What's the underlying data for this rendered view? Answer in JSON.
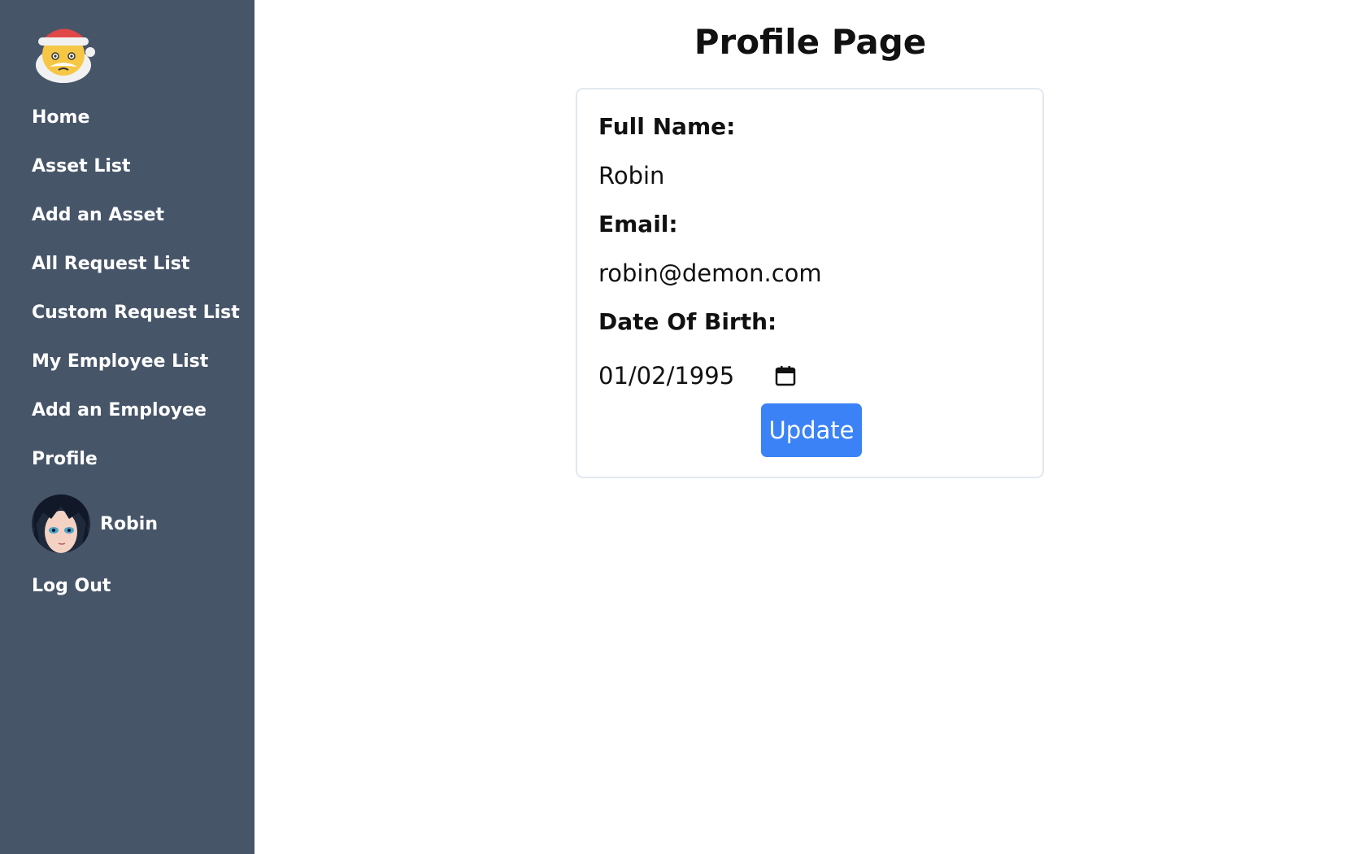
{
  "sidebar": {
    "logo_icon": "santa-emoji-icon",
    "items": [
      {
        "label": "Home"
      },
      {
        "label": "Asset List"
      },
      {
        "label": "Add an Asset"
      },
      {
        "label": "All Request List"
      },
      {
        "label": "Custom Request List"
      },
      {
        "label": "My Employee List"
      },
      {
        "label": "Add an Employee"
      },
      {
        "label": "Profile"
      }
    ],
    "user": {
      "name": "Robin",
      "avatar_icon": "user-avatar"
    },
    "logout_label": "Log Out",
    "background": "#475569"
  },
  "main": {
    "title": "Profile Page",
    "form": {
      "full_name_label": "Full Name:",
      "full_name_value": "Robin",
      "email_label": "Email:",
      "email_value": "robin@demon.com",
      "dob_label": "Date Of Birth:",
      "dob_value": "01/02/1995",
      "dob_icon": "calendar-icon",
      "update_label": "Update",
      "update_color": "#3b82f6"
    }
  }
}
